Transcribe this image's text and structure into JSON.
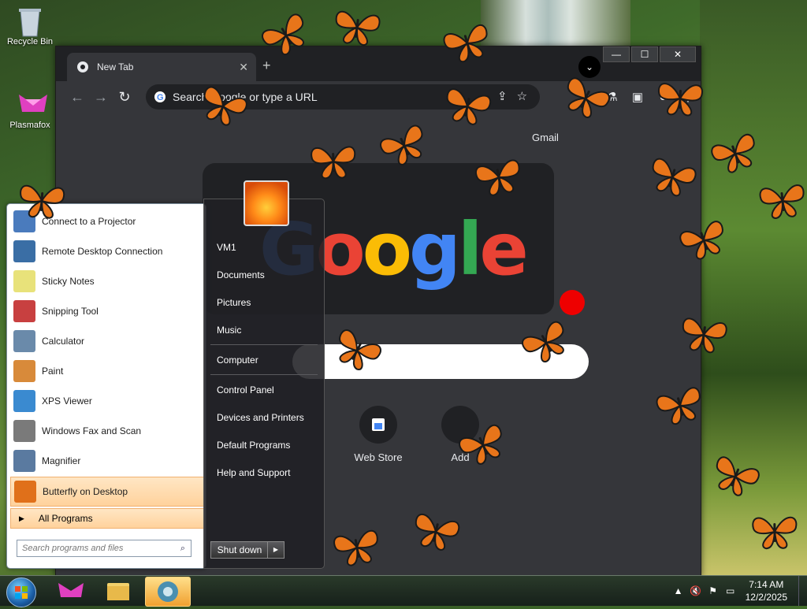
{
  "desktop": {
    "icons": [
      {
        "label": "Recycle Bin",
        "icon": "recycle-bin-icon"
      },
      {
        "label": "Plasmafox",
        "icon": "plasmafox-icon"
      }
    ]
  },
  "browser": {
    "tab_title": "New Tab",
    "omnibox_placeholder": "Search Google or type a URL",
    "ntp": {
      "gmail_label": "Gmail",
      "logo_letters": [
        "G",
        "o",
        "o",
        "g",
        "l",
        "e"
      ],
      "shortcuts": [
        {
          "label": "Web Store"
        },
        {
          "label": "Add"
        }
      ]
    },
    "window_controls": {
      "minimize": "—",
      "maximize": "☐",
      "close": "✕"
    }
  },
  "start_menu": {
    "programs": [
      {
        "label": "Connect to a Projector",
        "icon": "projector-icon",
        "color": "#4a7bbd"
      },
      {
        "label": "Remote Desktop Connection",
        "icon": "remote-desktop-icon",
        "color": "#3a6ea5"
      },
      {
        "label": "Sticky Notes",
        "icon": "sticky-notes-icon",
        "color": "#e8e27a"
      },
      {
        "label": "Snipping Tool",
        "icon": "snipping-tool-icon",
        "color": "#c84040"
      },
      {
        "label": "Calculator",
        "icon": "calculator-icon",
        "color": "#6a8aaa"
      },
      {
        "label": "Paint",
        "icon": "paint-icon",
        "color": "#d88a3a"
      },
      {
        "label": "XPS Viewer",
        "icon": "xps-viewer-icon",
        "color": "#3a8ad0"
      },
      {
        "label": "Windows Fax and Scan",
        "icon": "fax-scan-icon",
        "color": "#7a7a7a"
      },
      {
        "label": "Magnifier",
        "icon": "magnifier-icon",
        "color": "#5a7aa0"
      },
      {
        "label": "Butterfly on Desktop",
        "icon": "butterfly-icon",
        "color": "#e0701a"
      }
    ],
    "all_programs_label": "All Programs",
    "search_placeholder": "Search programs and files",
    "places": [
      {
        "label": "VM1"
      },
      {
        "label": "Documents"
      },
      {
        "label": "Pictures"
      },
      {
        "label": "Music"
      },
      {
        "label": "Computer"
      },
      {
        "label": "Control Panel"
      },
      {
        "label": "Devices and Printers"
      },
      {
        "label": "Default Programs"
      },
      {
        "label": "Help and Support"
      }
    ],
    "shutdown_label": "Shut down"
  },
  "taskbar": {
    "time": "7:14 AM",
    "date": "12/2/2025"
  },
  "colors": {
    "butterfly": "#e8751a",
    "taskbar_active": "#f0a030",
    "highlight": "#ffd29c"
  }
}
